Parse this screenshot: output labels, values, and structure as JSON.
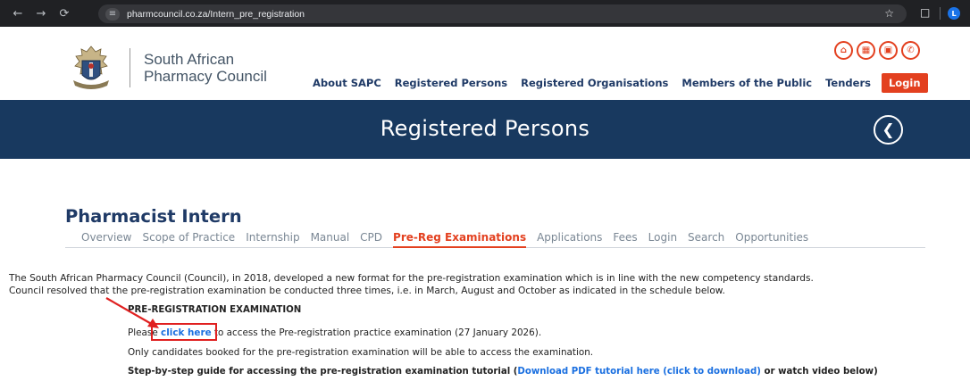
{
  "browser": {
    "url": "pharmcouncil.co.za/Intern_pre_registration",
    "profile_initial": "L"
  },
  "header": {
    "org_name_line1": "South African",
    "org_name_line2": "Pharmacy Council",
    "quick_icons": [
      "home-icon",
      "calendar-icon",
      "book-icon",
      "phone-icon"
    ],
    "nav": [
      "About SAPC",
      "Registered Persons",
      "Registered Organisations",
      "Members of the Public",
      "Tenders"
    ],
    "login_label": "Login",
    "accent_color": "#e3401f",
    "brand_color": "#18395f"
  },
  "banner": {
    "title": "Registered Persons"
  },
  "main": {
    "page_title": "Pharmacist Intern",
    "tabs": [
      {
        "label": "Overview"
      },
      {
        "label": "Scope of Practice"
      },
      {
        "label": "Internship"
      },
      {
        "label": "Manual"
      },
      {
        "label": "CPD"
      },
      {
        "label": "Pre-Reg Examinations",
        "active": true
      },
      {
        "label": "Applications"
      },
      {
        "label": "Fees"
      },
      {
        "label": "Login"
      },
      {
        "label": "Search"
      },
      {
        "label": "Opportunities"
      }
    ],
    "intro_line1": "The South African Pharmacy Council (Council), in 2018, developed a new format for the pre-registration examination which is in line with the new competency standards.",
    "intro_line2": "Council resolved that the pre-registration examination be conducted three times, i.e. in March, August and October as indicated in the schedule below.",
    "section_heading": "PRE-REGISTRATION EXAMINATION",
    "access_prefix": "Please ",
    "access_link": "click here",
    "access_suffix": " to access the Pre-registration practice examination (27 January 2026).",
    "only_candidates": "Only candidates booked for the pre-registration examination will be able to access the examination.",
    "guide_prefix": "Step-by-step guide for accessing the pre-registration examination tutorial (",
    "guide_link": "Download PDF tutorial here (click to download)",
    "guide_suffix": " or watch video below)"
  }
}
